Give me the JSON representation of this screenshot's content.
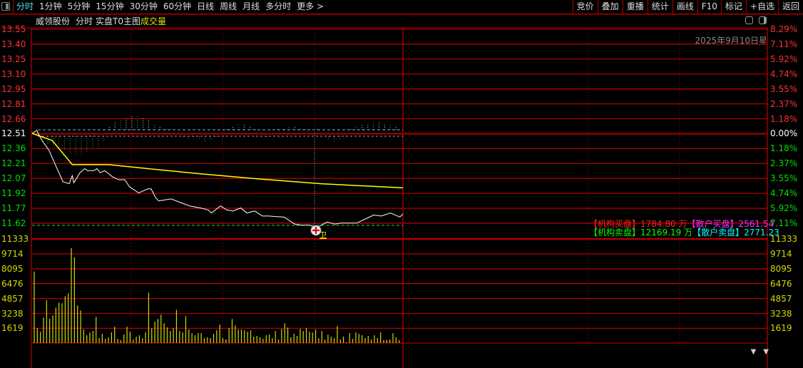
{
  "topbar": {
    "tabs": [
      "分时",
      "1分钟",
      "5分钟",
      "15分钟",
      "30分钟",
      "60分钟",
      "日线",
      "周线",
      "月线",
      "多分时",
      "更多 >"
    ],
    "active_tab": 0,
    "tools": [
      "竞价",
      "叠加",
      "重播",
      "统计",
      "画线",
      "F10",
      "标记",
      "+自选",
      "返回"
    ]
  },
  "title": {
    "stock_name": "威领股份",
    "mode": "分时",
    "indicator": "实盘T0主图",
    "volume_label": "成交量"
  },
  "date_text": "2025年9月10日星",
  "price_axis": {
    "left": [
      "13.55",
      "13.40",
      "13.25",
      "13.10",
      "12.95",
      "12.81",
      "12.66",
      "12.51",
      "12.36",
      "12.21",
      "12.07",
      "11.92",
      "11.77",
      "11.62"
    ],
    "right": [
      "8.29%",
      "7.11%",
      "5.92%",
      "4.74%",
      "3.55%",
      "2.37%",
      "1.18%",
      "0.00%",
      "1.18%",
      "2.37%",
      "3.55%",
      "4.74%",
      "5.92%",
      "7.11%"
    ]
  },
  "volume_axis": [
    "11333",
    "9714",
    "8095",
    "6476",
    "4857",
    "3238",
    "1619"
  ],
  "flow": {
    "inst_buy_label": "【机构买盘】",
    "inst_buy_value": "1784.80 万",
    "retail_buy_label": "【散户买盘】",
    "retail_buy_value": "2561.54",
    "inst_sell_label": "【机构卖盘】",
    "inst_sell_value": "12169.19 万",
    "retail_sell_label": "【散户卖盘】",
    "retail_sell_value": "2771.23"
  },
  "marker": {
    "label": "卫"
  },
  "colors": {
    "up": "#ff3030",
    "down": "#00e000",
    "grid": "#b00000",
    "price": "#ffffff",
    "avg": "#ffff00",
    "volume": "#d8d800"
  },
  "chart_data": {
    "type": "line",
    "title": "威领股份 分时",
    "prev_close": 12.51,
    "x_range_minutes": [
      0,
      240
    ],
    "ylim": [
      11.62,
      13.55
    ],
    "volume_ylim": [
      0,
      11333
    ],
    "price_series": [
      [
        0,
        12.51
      ],
      [
        3,
        12.54
      ],
      [
        6,
        12.45
      ],
      [
        11,
        12.34
      ],
      [
        15,
        12.2
      ],
      [
        20,
        12.03
      ],
      [
        24,
        12.01
      ],
      [
        26,
        12.09
      ],
      [
        27,
        12.02
      ],
      [
        31,
        12.12
      ],
      [
        34,
        12.16
      ],
      [
        36,
        12.14
      ],
      [
        40,
        12.14
      ],
      [
        42,
        12.16
      ],
      [
        44,
        12.12
      ],
      [
        47,
        12.14
      ],
      [
        52,
        12.08
      ],
      [
        56,
        12.05
      ],
      [
        60,
        12.05
      ],
      [
        63,
        11.98
      ],
      [
        69,
        11.92
      ],
      [
        75,
        11.96
      ],
      [
        77,
        11.96
      ],
      [
        80,
        11.87
      ],
      [
        82,
        11.84
      ],
      [
        86,
        11.85
      ],
      [
        90,
        11.86
      ],
      [
        95,
        11.83
      ],
      [
        102,
        11.79
      ],
      [
        109,
        11.77
      ],
      [
        114,
        11.75
      ],
      [
        116,
        11.72
      ],
      [
        122,
        11.79
      ],
      [
        126,
        11.75
      ],
      [
        130,
        11.74
      ],
      [
        135,
        11.77
      ],
      [
        139,
        11.72
      ],
      [
        144,
        11.74
      ],
      [
        149,
        11.69
      ],
      [
        153,
        11.69
      ],
      [
        163,
        11.68
      ],
      [
        170,
        11.61
      ],
      [
        174,
        11.6
      ],
      [
        180,
        11.6
      ],
      [
        184,
        11.56
      ],
      [
        187,
        11.6
      ],
      [
        191,
        11.63
      ],
      [
        196,
        11.61
      ],
      [
        200,
        11.62
      ],
      [
        210,
        11.62
      ],
      [
        217,
        11.67
      ],
      [
        221,
        11.7
      ],
      [
        226,
        11.69
      ],
      [
        232,
        11.72
      ],
      [
        238,
        11.68
      ],
      [
        240,
        11.71
      ]
    ],
    "avg_series": [
      [
        0,
        12.51
      ],
      [
        13,
        12.44
      ],
      [
        26,
        12.2
      ],
      [
        50,
        12.2
      ],
      [
        75,
        12.16
      ],
      [
        108,
        12.11
      ],
      [
        145,
        12.06
      ],
      [
        187,
        12.01
      ],
      [
        240,
        11.97
      ]
    ],
    "volume": [
      7787,
      1619,
      1234,
      2776,
      4652,
      2647,
      3007,
      3855,
      4395,
      4318,
      5089,
      5397,
      10331,
      9329,
      4086,
      3547,
      1465,
      848,
      1156,
      1311,
      2853,
      540,
      1002,
      463,
      617,
      1156,
      1773,
      463,
      308,
      925,
      1773,
      1234,
      386,
      694,
      848,
      540,
      1156,
      5474,
      1619,
      2313,
      2621,
      3084,
      2159,
      1696,
      1311,
      1619,
      3624,
      1311,
      1156,
      2930,
      1465,
      1079,
      848,
      1079,
      1079,
      540,
      617,
      540,
      1002,
      1388,
      2005,
      540,
      386,
      1619,
      2621,
      1928,
      1465,
      1465,
      1388,
      1234,
      1388,
      694,
      771,
      617,
      463,
      848,
      925,
      540,
      1311,
      386,
      1542,
      2159,
      1696,
      617,
      1002,
      771,
      1542,
      1311,
      1619,
      1234,
      1156,
      1465,
      540,
      1311,
      386,
      925,
      694,
      540,
      1850,
      386,
      694,
      100,
      1079,
      463,
      1156,
      1002,
      848,
      540,
      771,
      386,
      848,
      540,
      1156,
      308,
      308,
      386,
      1079,
      617,
      308
    ],
    "flow_bars": [
      0,
      -3,
      -4,
      -5,
      -6,
      -7,
      -8,
      -9,
      -9,
      -8,
      -6,
      -5,
      -3,
      2,
      4,
      5,
      6,
      7,
      7,
      6,
      5,
      3,
      2,
      1,
      1,
      0,
      -1,
      -2,
      -1,
      -2,
      -3,
      -2,
      -1,
      0,
      1,
      2,
      3,
      3,
      2,
      1,
      0,
      -1,
      0,
      1,
      1,
      2,
      2,
      1,
      1,
      0,
      1,
      0,
      -2,
      -3,
      -2,
      0,
      1,
      2,
      3,
      3,
      4,
      4,
      3,
      3,
      2
    ]
  }
}
